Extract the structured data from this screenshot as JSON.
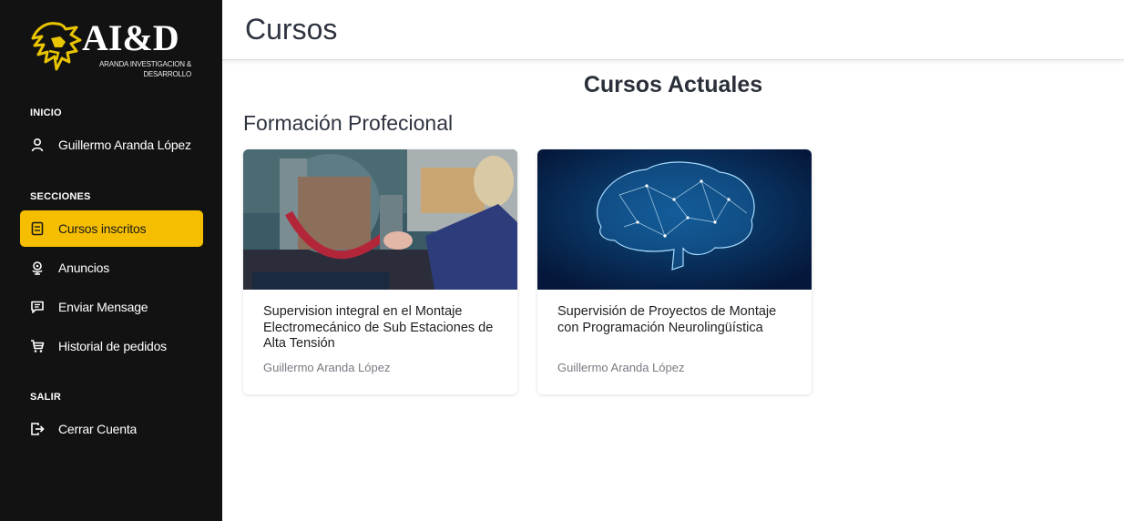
{
  "brand": {
    "name": "AI&D",
    "subtitle": "ARANDA INVESTIGACION & DESARROLLO"
  },
  "sidebar": {
    "sections": [
      {
        "title": "INICIO",
        "items": [
          {
            "label": "Guillermo Aranda López",
            "icon": "user-icon"
          }
        ]
      },
      {
        "title": "SECCIONES",
        "items": [
          {
            "label": "Cursos inscritos",
            "icon": "book-icon",
            "active": true
          },
          {
            "label": "Anuncios",
            "icon": "globe-pin-icon"
          },
          {
            "label": "Enviar Mensage",
            "icon": "message-icon"
          },
          {
            "label": "Historial de pedidos",
            "icon": "cart-icon"
          }
        ]
      },
      {
        "title": "SALIR",
        "items": [
          {
            "label": "Cerrar Cuenta",
            "icon": "logout-icon"
          }
        ]
      }
    ]
  },
  "header": {
    "title": "Cursos"
  },
  "main": {
    "heading": "Cursos Actuales",
    "group_title": "Formación Profecional",
    "courses": [
      {
        "title": "Supervision integral en el Montaje Electromecánico de Sub Estaciones de Alta Tensión",
        "author": "Guillermo Aranda López",
        "image": "factory-worker-photo"
      },
      {
        "title": "Supervisión de Proyectos de Montaje con Programación Neurolingüística",
        "author": "Guillermo Aranda López",
        "image": "digital-brain-photo"
      }
    ]
  },
  "colors": {
    "sidebar_bg": "#121212",
    "accent": "#f5be00",
    "text": "#2e3440"
  }
}
